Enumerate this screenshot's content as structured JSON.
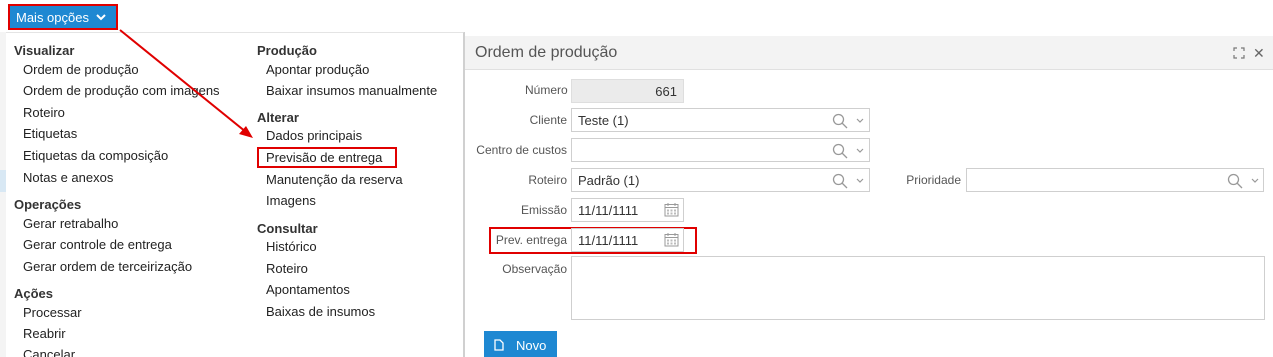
{
  "topbar": {
    "more_options_label": "Mais opções"
  },
  "menu": {
    "col1": [
      {
        "section": "Visualizar",
        "items": [
          "Ordem de produção",
          "Ordem de produção com imagens",
          "Roteiro",
          "Etiquetas",
          "Etiquetas da composição",
          "Notas e anexos"
        ]
      },
      {
        "section": "Operações",
        "items": [
          "Gerar retrabalho",
          "Gerar controle de entrega",
          "Gerar ordem de terceirização"
        ]
      },
      {
        "section": "Ações",
        "items": [
          "Processar",
          "Reabrir",
          "Cancelar"
        ]
      }
    ],
    "col2": [
      {
        "section": "Produção",
        "items": [
          "Apontar produção",
          "Baixar insumos manualmente"
        ]
      },
      {
        "section": "Alterar",
        "items": [
          "Dados principais",
          "Previsão de entrega",
          "Manutenção da reserva",
          "Imagens"
        ]
      },
      {
        "section": "Consultar",
        "items": [
          "Histórico",
          "Roteiro",
          "Apontamentos",
          "Baixas de insumos"
        ]
      }
    ]
  },
  "dialog": {
    "title": "Ordem de produção",
    "fields": {
      "numero": {
        "label": "Número",
        "value": "661"
      },
      "cliente": {
        "label": "Cliente",
        "value": "Teste (1)"
      },
      "centro_custos": {
        "label": "Centro de custos",
        "value": ""
      },
      "roteiro": {
        "label": "Roteiro",
        "value": "Padrão (1)"
      },
      "prioridade": {
        "label": "Prioridade",
        "value": ""
      },
      "emissao": {
        "label": "Emissão",
        "value": "11/11/1111"
      },
      "prev_entrega": {
        "label": "Prev. entrega",
        "value": "11/11/1111"
      },
      "observacao": {
        "label": "Observação",
        "value": ""
      }
    },
    "new_button_label": "Novo"
  },
  "colors": {
    "accent": "#1e88d2",
    "highlight": "#e00000"
  }
}
